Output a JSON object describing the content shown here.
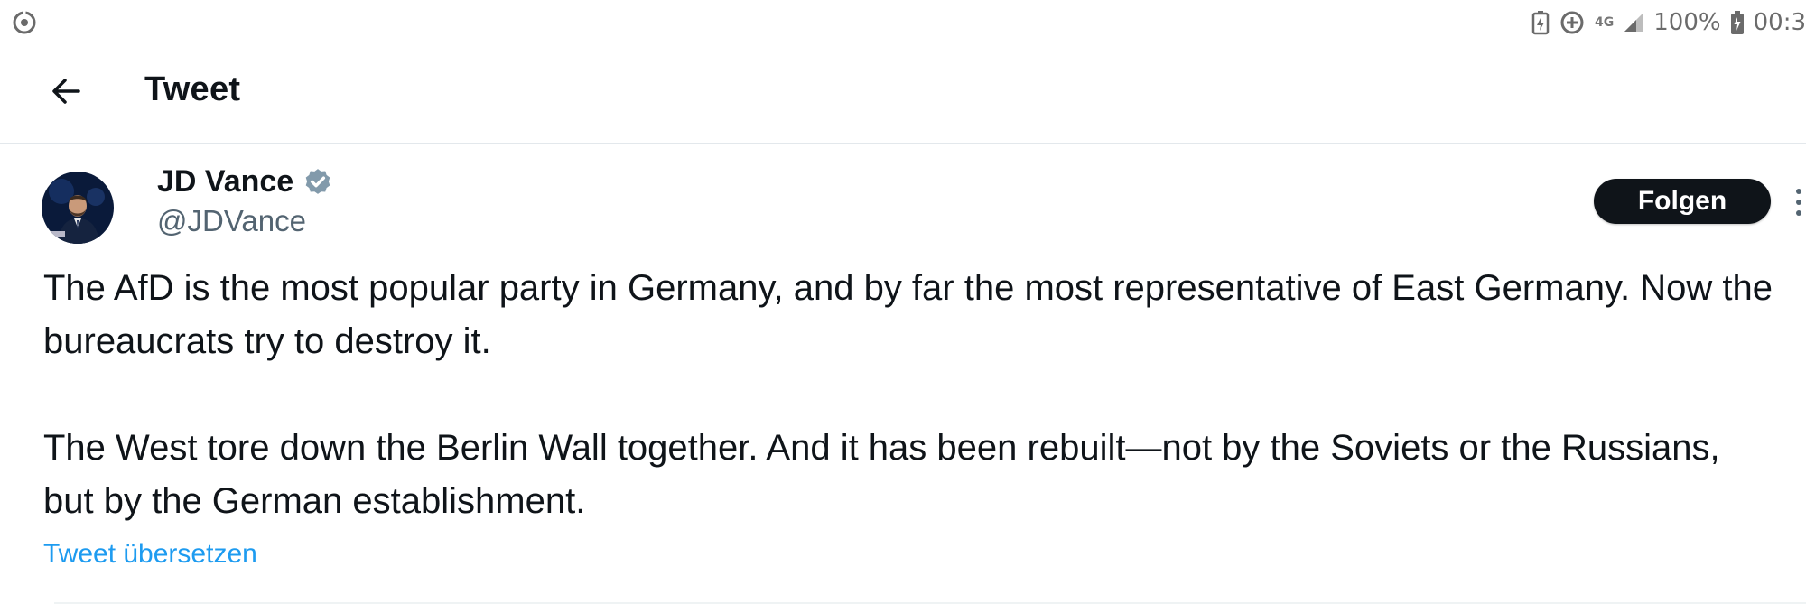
{
  "status_bar": {
    "network": "4G",
    "battery": "100%",
    "time": "00:3"
  },
  "header": {
    "title": "Tweet"
  },
  "tweet": {
    "author_name": "JD Vance",
    "author_handle": "@JDVance",
    "follow_label": "Folgen",
    "paragraphs": [
      "The AfD is the most popular party in Germany, and by far the most representative of East Germany. Now the bureaucrats try to destroy it.",
      "The West tore down the Berlin Wall together. And it has been rebuilt—not by the Soviets or the Russians, but by the German establishment."
    ],
    "translate_label": "Tweet übersetzen"
  },
  "colors": {
    "text": "#0f1419",
    "secondary": "#536471",
    "link": "#1d9bf0",
    "verified_badge": "#829aab",
    "follow_bg": "#0f1419"
  },
  "icons": {
    "status_left": "sync-icon",
    "back": "arrow-left-icon",
    "verified": "verified-badge-icon",
    "more": "more-vertical-icon"
  }
}
